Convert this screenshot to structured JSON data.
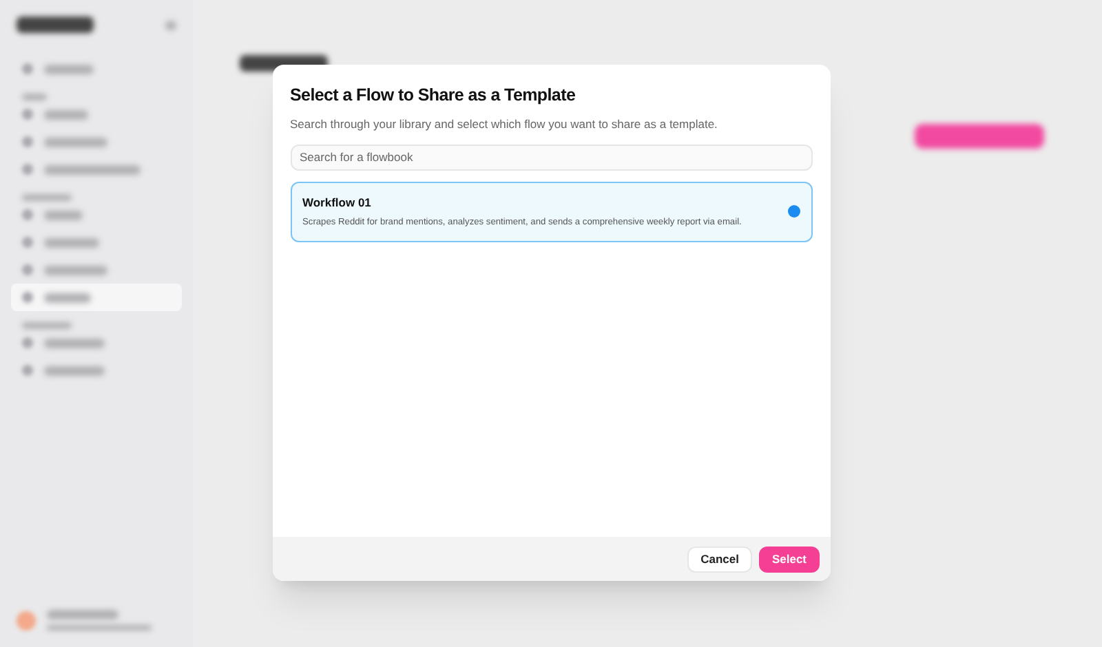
{
  "dialog": {
    "title": "Select a Flow to Share as a Template",
    "subtitle": "Search through your library and select which flow you want to share as a template.",
    "search": {
      "placeholder": "Search for a flowbook"
    },
    "flows": [
      {
        "name": "Workflow 01",
        "description": "Scrapes Reddit for brand mentions, analyzes sentiment, and sends a comprehensive weekly report via email.",
        "selected": true
      }
    ],
    "buttons": [
      {
        "label": "Cancel",
        "kind": "secondary"
      },
      {
        "label": "Select",
        "kind": "primary"
      }
    ]
  }
}
